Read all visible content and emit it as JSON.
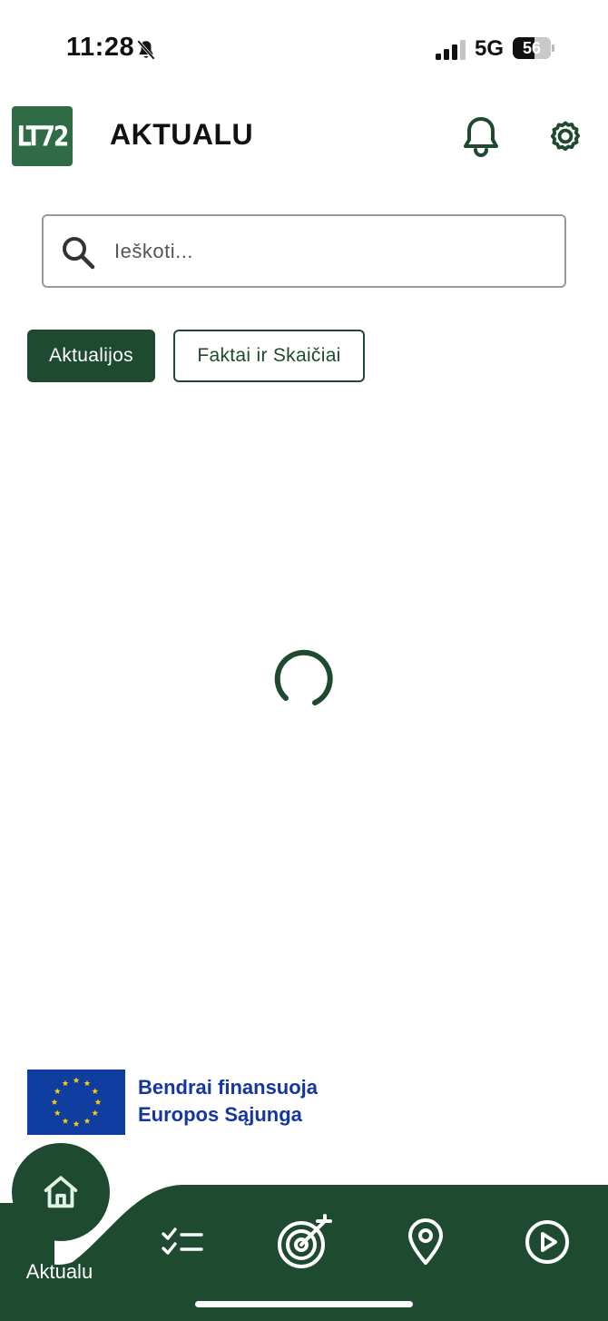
{
  "status_bar": {
    "time": "11:28",
    "network": "5G",
    "battery": "56"
  },
  "header": {
    "logo_text": "LT72",
    "title": "AKTUALU"
  },
  "search": {
    "placeholder": "Ieškoti..."
  },
  "tabs": [
    {
      "label": "Aktualijos",
      "active": true
    },
    {
      "label": "Faktai ir Skaičiai",
      "active": false
    }
  ],
  "funding_banner": {
    "line1": "Bendrai finansuoja",
    "line2": "Europos Sąjunga"
  },
  "bottom_nav": {
    "items": [
      {
        "label": "Aktualu",
        "icon": "home-icon",
        "active": true
      },
      {
        "icon": "checklist-icon"
      },
      {
        "icon": "target-icon"
      },
      {
        "icon": "location-pin-icon"
      },
      {
        "icon": "play-circle-icon"
      }
    ]
  },
  "colors": {
    "brand_green": "#1e4a30",
    "logo_green": "#2f6b45",
    "eu_blue": "#0f3ea0",
    "eu_text_blue": "#1436a3"
  }
}
